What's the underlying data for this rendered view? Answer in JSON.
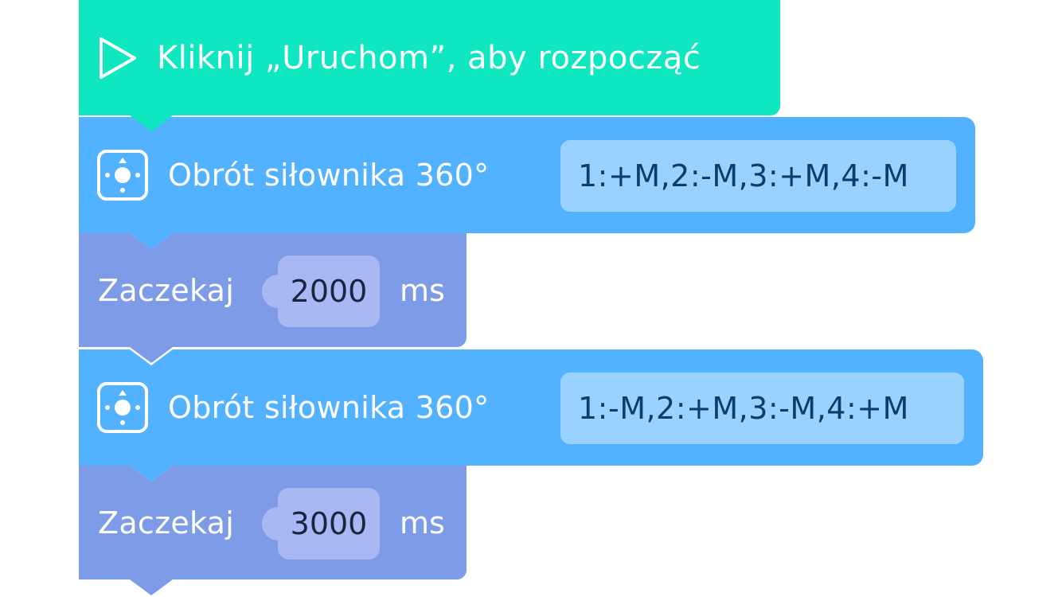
{
  "start_block": {
    "label": "Kliknij „Uruchom”, aby rozpocząć",
    "icon": "play-icon",
    "color": "#0fe7c1"
  },
  "blocks": [
    {
      "type": "servo",
      "label": "Obrót siłownika 360°",
      "value": "1:+M,2:-M,3:+M,4:-M",
      "icon": "servo-icon",
      "color": "#52b2ff"
    },
    {
      "type": "wait",
      "label": "Zaczekaj",
      "value": "2000",
      "unit": "ms",
      "color": "#7e9be8"
    },
    {
      "type": "servo",
      "label": "Obrót siłownika 360°",
      "value": "1:-M,2:+M,3:-M,4:+M",
      "icon": "servo-icon",
      "color": "#52b2ff"
    },
    {
      "type": "wait",
      "label": "Zaczekaj",
      "value": "3000",
      "unit": "ms",
      "color": "#7e9be8"
    }
  ]
}
